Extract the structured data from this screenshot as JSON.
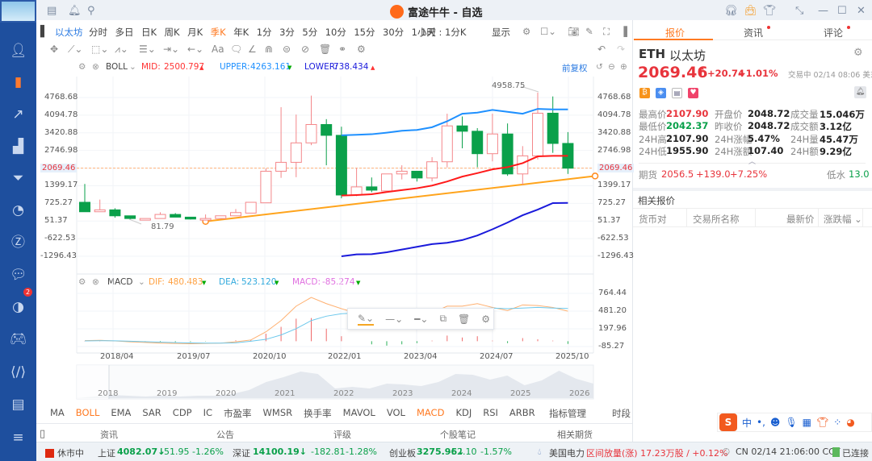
{
  "window": {
    "title": "富途牛牛 - 自选"
  },
  "toolbar": {
    "symbol": "以太坊",
    "periods": [
      "分时",
      "多日",
      "日K",
      "周K",
      "月K",
      "季K",
      "年K",
      "1分",
      "3分",
      "5分",
      "10分",
      "15分",
      "30分",
      "1小时"
    ],
    "active_period": "季K",
    "interval_select": "1天 : 1分K",
    "display": "显示",
    "adjust": "前复权"
  },
  "boll": {
    "name": "BOLL",
    "mid_label": "MID:",
    "mid": "2500.797",
    "upper_label": "UPPER:",
    "upper": "4263.161",
    "lower_label": "LOWER:",
    "lower": "738.434"
  },
  "macd": {
    "name": "MACD",
    "dif_label": "DIF:",
    "dif": "480.483",
    "dea_label": "DEA:",
    "dea": "523.120",
    "macd_label": "MACD:",
    "macd": "-85.274"
  },
  "chart_data": [
    {
      "type": "candlestick",
      "title": "ETH 以太坊 季K",
      "y_ticks": [
        "4768.68",
        "4094.78",
        "3420.88",
        "2746.98",
        "2069.46",
        "1399.17",
        "725.27",
        "51.37",
        "-622.53",
        "-1296.43"
      ],
      "current_price": 2069.46,
      "annotations": {
        "max": "4958.75",
        "min": "81.79"
      },
      "ohlc": [
        [
          766,
          405,
          1468,
          405
        ],
        [
          405,
          477,
          870,
          405
        ],
        [
          477,
          250,
          540,
          178
        ],
        [
          250,
          147,
          250,
          96
        ],
        [
          85,
          147,
          147,
          85
        ],
        [
          147,
          302,
          385,
          147
        ],
        [
          302,
          199,
          354,
          199
        ],
        [
          199,
          127,
          199,
          110
        ],
        [
          85,
          147,
          302,
          82
        ],
        [
          147,
          250,
          250,
          140
        ],
        [
          250,
          374,
          508,
          250
        ],
        [
          354,
          766,
          766,
          354
        ],
        [
          746,
          1953,
          2060,
          746
        ],
        [
          1953,
          2293,
          4400,
          1700
        ],
        [
          2293,
          3036,
          4118,
          1725
        ],
        [
          3036,
          3737,
          4840,
          2950
        ],
        [
          3737,
          3324,
          3943,
          2180
        ],
        [
          3324,
          1045,
          3654,
          920
        ],
        [
          1045,
          1355,
          2076,
          1000
        ],
        [
          1355,
          1230,
          1715,
          1150
        ],
        [
          1200,
          1850,
          1850,
          1180
        ],
        [
          1850,
          1953,
          2180,
          1640
        ],
        [
          1953,
          1695,
          1953,
          1560
        ],
        [
          1695,
          2314,
          2490,
          1560
        ],
        [
          2314,
          3685,
          4150,
          2100
        ],
        [
          3685,
          3480,
          4047,
          2830
        ],
        [
          3480,
          2623,
          3600,
          2105
        ],
        [
          2623,
          3376,
          4150,
          2330
        ],
        [
          3376,
          1850,
          3778,
          1777
        ],
        [
          1850,
          2540,
          2912,
          1437
        ],
        [
          2540,
          4170,
          4958.75,
          2400
        ],
        [
          4170,
          3015,
          4810,
          2654
        ],
        [
          3015,
          2069.46,
          3448,
          1850
        ]
      ],
      "boll_start_index": 17,
      "boll_upper": [
        3324,
        3345,
        3366,
        3427,
        3500,
        3530,
        3634,
        3861,
        4150,
        4191,
        4294,
        4222,
        4150,
        4335,
        4315,
        4315
      ],
      "boll_mid": [
        1024,
        1045,
        1076,
        1159,
        1231,
        1303,
        1406,
        1561,
        1747,
        1881,
        2025,
        2108,
        2262,
        2520,
        2541,
        2541
      ],
      "boll_lower": [
        -1297,
        -1224,
        -1214,
        -1142,
        -1039,
        -935,
        -832,
        -781,
        -678,
        -503,
        -265,
        -7,
        271,
        488,
        735,
        745
      ],
      "trendline": {
        "from": [
          8,
          35
        ],
        "to": [
          33.8,
          1770
        ]
      }
    },
    {
      "type": "line",
      "title": "MACD",
      "y_ticks": [
        "764.44",
        "481.20",
        "197.96",
        "-85.27"
      ],
      "dif": [
        10,
        15,
        5,
        -10,
        -20,
        -30,
        -35,
        -40,
        -35,
        -30,
        -10,
        20,
        150,
        330,
        560,
        700,
        600,
        520,
        450,
        400,
        370,
        380,
        400,
        450,
        560,
        560,
        600,
        540,
        490,
        580,
        570,
        540,
        480
      ],
      "dea": [
        5,
        8,
        6,
        0,
        -8,
        -15,
        -22,
        -28,
        -30,
        -30,
        -25,
        0,
        30,
        100,
        200,
        330,
        400,
        440,
        450,
        450,
        440,
        430,
        430,
        440,
        470,
        500,
        520,
        530,
        520,
        530,
        540,
        530,
        523
      ]
    }
  ],
  "x_axis": [
    "2018/04",
    "2019/07",
    "2020/10",
    "2022/01",
    "2023/04",
    "2024/07",
    "2025/10"
  ],
  "navigator": {
    "years": [
      "2018",
      "2019",
      "2020",
      "2021",
      "2022",
      "2023",
      "2024",
      "2025",
      "2026"
    ]
  },
  "indicators": {
    "items": [
      "MA",
      "BOLL",
      "EMA",
      "SAR",
      "CDP",
      "IC",
      "市盈率",
      "WMSR",
      "换手率",
      "MAVOL",
      "VOL",
      "MACD",
      "KDJ",
      "RSI",
      "ARBR"
    ],
    "manage": "指标管理",
    "timeslot": "时段"
  },
  "info_tabs": [
    "资讯",
    "公告",
    "评级",
    "个股笔记",
    "相关期货"
  ],
  "status": {
    "market_state": "休市中",
    "indices": [
      {
        "name": "上证",
        "value": "4082.07↓",
        "change": "-51.95",
        "pct": "-1.26%"
      },
      {
        "name": "深证",
        "value": "14100.19↓",
        "change": "-182.81",
        "pct": "-1.28%"
      },
      {
        "name": "创业板",
        "value": "3275.96↓",
        "change": "-52.10",
        "pct": "-1.57%"
      }
    ],
    "news_stock": "美国电力",
    "news_text": "区间放量(涨) 17.23万股 / +0.12%",
    "clock": "CN 02/14 21:06:00 CCT",
    "connection": "已连接"
  },
  "right": {
    "tabs": [
      "报价",
      "资讯",
      "评论"
    ],
    "symbol": "ETH",
    "name": "以太坊",
    "price": "2069.46",
    "arrow": "↑",
    "change": "+20.74",
    "pct": "+1.01%",
    "trade_status": "交易中 02/14 08:06 美东",
    "stats": [
      [
        {
          "l": "最高价",
          "v": "2107.90",
          "c": "red"
        },
        {
          "l": "开盘价",
          "v": "2048.72",
          "c": ""
        },
        {
          "l": "成交量",
          "v": "15.046万",
          "c": ""
        }
      ],
      [
        {
          "l": "最低价",
          "v": "2042.37",
          "c": "green"
        },
        {
          "l": "昨收价",
          "v": "2048.72",
          "c": ""
        },
        {
          "l": "成交额",
          "v": "3.12亿",
          "c": ""
        }
      ],
      [
        {
          "l": "24H高",
          "v": "2107.90",
          "c": ""
        },
        {
          "l": "24H涨幅",
          "v": "5.47%",
          "c": ""
        },
        {
          "l": "24H量",
          "v": "45.47万",
          "c": ""
        }
      ],
      [
        {
          "l": "24H低",
          "v": "1955.90",
          "c": ""
        },
        {
          "l": "24H涨额",
          "v": "107.40",
          "c": ""
        },
        {
          "l": "24H额",
          "v": "9.29亿",
          "c": ""
        }
      ]
    ],
    "futures": {
      "label": "期货",
      "price": "2056.5",
      "change": "+139.0",
      "pct": "+7.25%",
      "basis_label": "低水",
      "basis": "13.0"
    },
    "related_title": "相关报价",
    "columns": [
      "货币对",
      "交易所名称",
      "最新价",
      "涨跌幅"
    ]
  },
  "ime": {
    "label": "中"
  },
  "colors": {
    "up": "#e8343c",
    "down": "#0aa04a",
    "accent": "#ff7a22",
    "boll_upper": "#1e90ff",
    "boll_mid": "#ff1a1a",
    "boll_lower": "#1a1adb",
    "trend": "#ffa41c"
  }
}
